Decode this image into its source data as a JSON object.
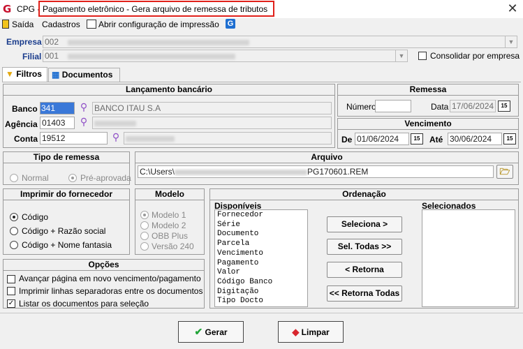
{
  "title": {
    "app": "CPG",
    "sep": "-",
    "text": "Pagamento eletrônico - Gera arquivo de remessa de tributos",
    "close": "✕"
  },
  "menu": {
    "exit": "Saída",
    "cadastros": "Cadastros",
    "print_config": "Abrir configuração de impressão"
  },
  "empresa": {
    "label": "Empresa",
    "value": "002"
  },
  "filial": {
    "label": "Filial",
    "value": "001",
    "consolidate_label": "Consolidar por empresa",
    "consolidate_checked": false
  },
  "tabs": [
    "Filtros",
    "Documentos"
  ],
  "lancamento": {
    "title": "Lançamento bancário",
    "banco_label": "Banco",
    "banco_code": "341",
    "banco_name": "BANCO ITAU S.A",
    "agencia_label": "Agência",
    "agencia_code": "01403",
    "conta_label": "Conta",
    "conta_code": "19512"
  },
  "remessa": {
    "title": "Remessa",
    "numero_label": "Número",
    "numero_value": "",
    "data_label": "Data",
    "data_value": "17/06/2024",
    "cal_label": "15"
  },
  "vencimento": {
    "title": "Vencimento",
    "de_label": "De",
    "de_value": "01/06/2024",
    "ate_label": "Até",
    "ate_value": "30/06/2024",
    "cal_label": "15"
  },
  "tipo_remessa": {
    "title": "Tipo de remessa",
    "options": [
      "Normal",
      "Pré-aprovada"
    ],
    "selected": "Pré-aprovada"
  },
  "arquivo": {
    "title": "Arquivo",
    "path_start": "C:\\Users\\",
    "path_end": "PG170601.REM"
  },
  "imprimir": {
    "title": "Imprimir do fornecedor",
    "options": [
      "Código",
      "Código + Razão social",
      "Código + Nome fantasia"
    ],
    "selected": "Código"
  },
  "modelo": {
    "title": "Modelo",
    "options": [
      "Modelo 1",
      "Modelo 2",
      "OBB Plus",
      "Versão 240"
    ],
    "selected": "Modelo 1"
  },
  "ordenacao": {
    "title": "Ordenação",
    "disponiveis_label": "Disponíveis",
    "selecionados_label": "Selecionados",
    "disponiveis": [
      "Fornecedor",
      "Série",
      "Documento",
      "Parcela",
      "Vencimento",
      "Pagamento",
      "Valor",
      "Código Banco",
      "Digitação",
      "Tipo Docto"
    ],
    "buttons": [
      "Seleciona >",
      "Sel. Todas >>",
      "< Retorna",
      "<< Retorna Todas"
    ]
  },
  "opcoes": {
    "title": "Opções",
    "items": [
      {
        "label": "Avançar página em novo vencimento/pagamento",
        "checked": false
      },
      {
        "label": "Imprimir linhas separadoras entre os documentos",
        "checked": false
      },
      {
        "label": "Listar os documentos para seleção",
        "checked": true
      }
    ]
  },
  "actions": {
    "gerar": "Gerar",
    "limpar": "Limpar"
  },
  "colors": {
    "accent": "#1a3c8c",
    "highlight_border": "#e0201a",
    "selection": "#3a78d8"
  }
}
